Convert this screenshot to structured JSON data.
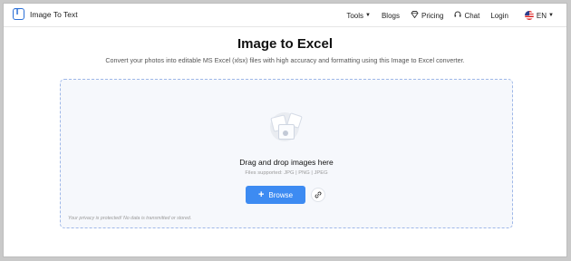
{
  "app": {
    "name": "Image To Text",
    "logo_letter": "T"
  },
  "nav": {
    "tools": "Tools",
    "blogs": "Blogs",
    "pricing": "Pricing",
    "chat": "Chat",
    "login": "Login",
    "language": "EN"
  },
  "page": {
    "title": "Image to Excel",
    "subtitle": "Convert your photos into editable MS Excel (xlsx) files with high accuracy and formatting using this Image to Excel converter."
  },
  "upload": {
    "drag_text": "Drag and drop images here",
    "files_supported": "Files supported: JPG | PNG | JPEG",
    "browse_label": "Browse",
    "privacy_note": "Your privacy is protected! No data is transmitted or stored."
  },
  "colors": {
    "accent": "#3d8bf2",
    "brand": "#2b6fd6",
    "dropzone_border": "#9fb8e8"
  },
  "icons": {
    "logo": "image-to-text-logo-icon",
    "tools_caret": "chevron-down-icon",
    "pricing": "diamond-icon",
    "chat": "headset-icon",
    "flag": "us-flag-icon",
    "browse_plus": "plus-icon",
    "link": "link-icon",
    "upload_illustration": "images-illustration-icon"
  }
}
